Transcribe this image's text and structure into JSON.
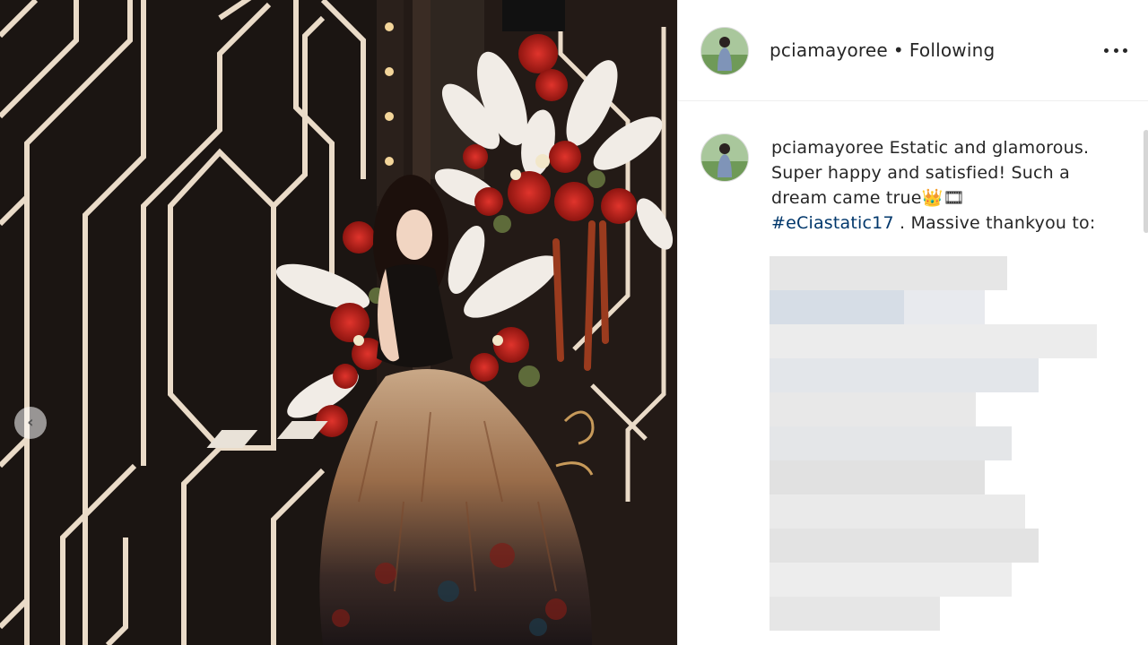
{
  "post": {
    "photo": {
      "alt_subject": "woman in feather gown seated before floral arrangement",
      "prev_icon": "chevron-left-icon",
      "prev_glyph": "‹"
    },
    "header": {
      "username": "pciamayoree",
      "separator": "•",
      "follow_status": "Following",
      "more_icon": "more-horizontal-icon"
    },
    "caption": {
      "username": "pciamayoree",
      "line1_text": "Estatic and glamorous.",
      "line2": "Super happy and satisfied! Such a",
      "line3": "dream came true👑🎞",
      "hashtag": "#eCiastatic17",
      "line4_rest": " . Massive thankyou to:"
    }
  },
  "colors": {
    "text": "#262626",
    "hashtag": "#00376b",
    "border": "#efefef",
    "wall": "#1a1512",
    "gold_lines": "#e9d6c2"
  }
}
